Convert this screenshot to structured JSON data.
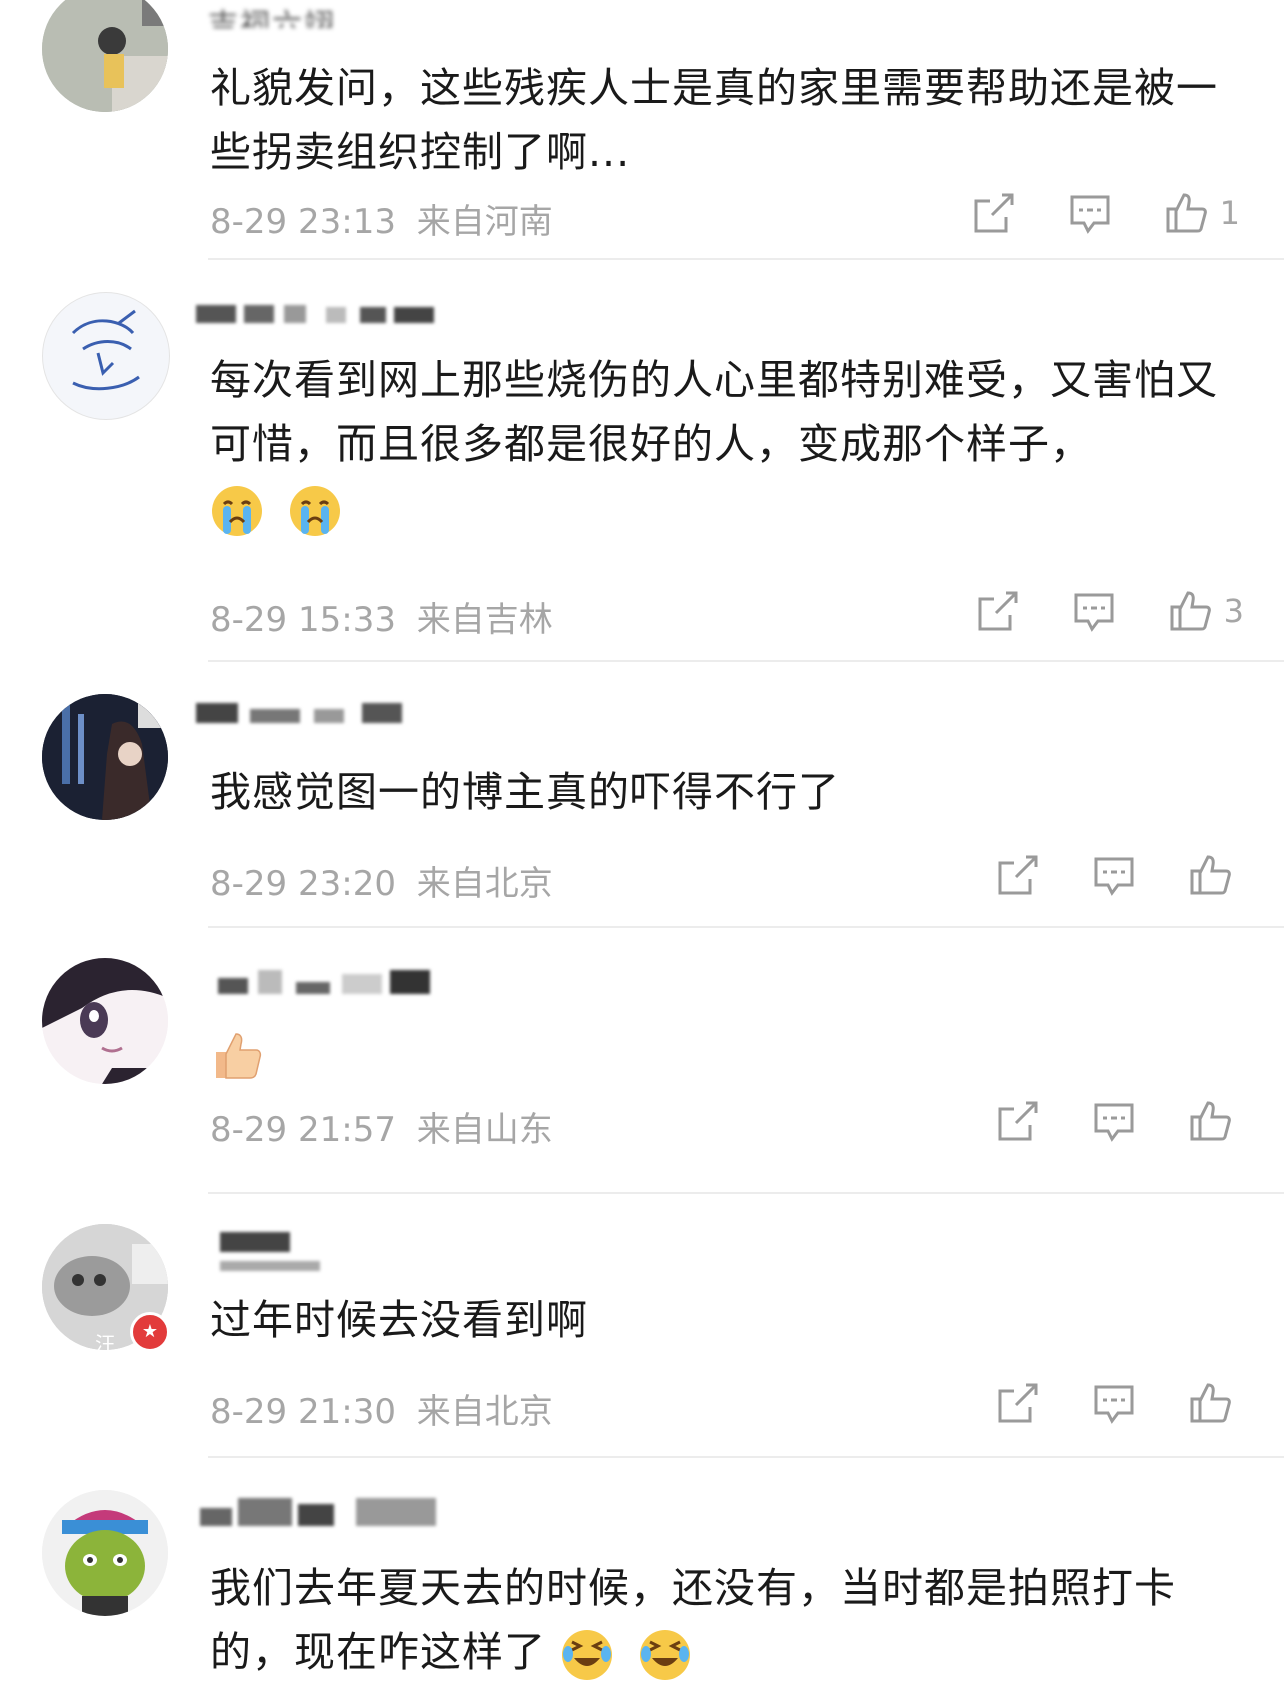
{
  "comments": [
    {
      "username": "吉祠六翊",
      "text": "礼貌发问，这些残疾人士是真的家里需要帮助还是被一些拐卖组织控制了啊...",
      "time": "8-29 23:13",
      "location": "来自河南",
      "likes": "1"
    },
    {
      "username": "",
      "text": "每次看到网上那些烧伤的人心里都特别难受，又害怕又可惜，而且很多都是很好的人，变成那个样子，",
      "emojis": [
        "crying-face",
        "crying-face"
      ],
      "time": "8-29 15:33",
      "location": "来自吉林",
      "likes": "3"
    },
    {
      "username": "",
      "text": "我感觉图一的博主真的吓得不行了",
      "time": "8-29 23:20",
      "location": "来自北京",
      "likes": ""
    },
    {
      "username": "",
      "text": "",
      "emojis": [
        "thumbs-up"
      ],
      "time": "8-29 21:57",
      "location": "来自山东",
      "likes": ""
    },
    {
      "username": "",
      "avatar_badge": "汪",
      "text": "过年时候去没看到啊",
      "time": "8-29 21:30",
      "location": "来自北京",
      "likes": ""
    },
    {
      "username": "",
      "text_line1": "我们去年夏天去的时候，还没有，当时都是拍照打卡",
      "text_line2": "的，现在咋这样了",
      "emojis": [
        "laughing-crying-face",
        "laughing-crying-face"
      ]
    }
  ],
  "colors": {
    "text": "#1a1a1a",
    "meta": "#a6a6a6",
    "divider": "#ececec",
    "icon": "#9a9a9a"
  }
}
